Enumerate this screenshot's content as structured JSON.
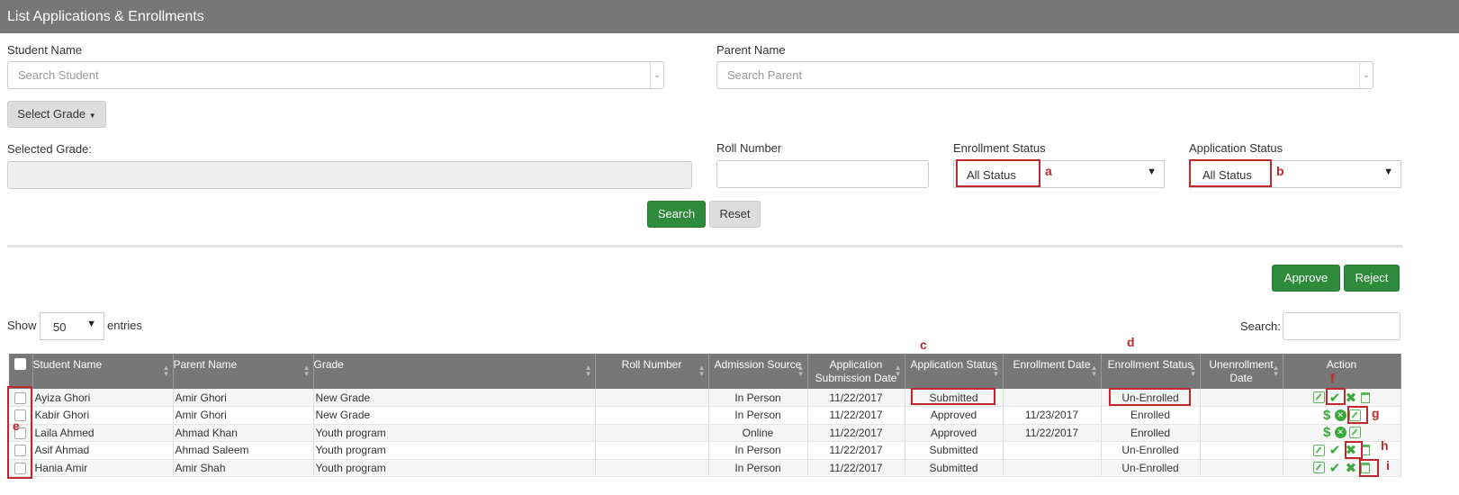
{
  "page_title": "List Applications & Enrollments",
  "filters": {
    "student_name_label": "Student Name",
    "student_placeholder": "Search Student",
    "parent_name_label": "Parent Name",
    "parent_placeholder": "Search Parent",
    "select_grade_label": "Select Grade",
    "selected_grade_label": "Selected Grade:",
    "roll_number_label": "Roll Number",
    "enrollment_status_label": "Enrollment Status",
    "enrollment_status_value": "All Status",
    "application_status_label": "Application Status",
    "application_status_value": "All Status",
    "search_button": "Search",
    "reset_button": "Reset"
  },
  "actions": {
    "approve_button": "Approve",
    "reject_button": "Reject"
  },
  "table_controls": {
    "show_label": "Show",
    "entries_value": "50",
    "entries_label": "entries",
    "search_label": "Search:"
  },
  "annotations": {
    "a": "a",
    "b": "b",
    "c": "c",
    "d": "d",
    "e": "e",
    "f": "f",
    "g": "g",
    "h": "h",
    "i": "i"
  },
  "columns": [
    "Student Name",
    "Parent Name",
    "Grade",
    "Roll Number",
    "Admission Source",
    "Application Submission Date",
    "Application Status",
    "Enrollment Date",
    "Enrollment Status",
    "Unenrollment Date",
    "Action"
  ],
  "rows": [
    {
      "student": "Ayiza Ghori",
      "parent": "Amir Ghori",
      "grade": "New Grade",
      "roll": "",
      "source": "In Person",
      "submitted": "11/22/2017",
      "app_status": "Submitted",
      "enroll_date": "",
      "enroll_status": "Un-Enrolled",
      "unenroll_date": "",
      "actions": [
        "edit-icon",
        "check-icon",
        "x-icon",
        "trash-icon"
      ]
    },
    {
      "student": "Kabir Ghori",
      "parent": "Amir Ghori",
      "grade": "New Grade",
      "roll": "",
      "source": "In Person",
      "submitted": "11/22/2017",
      "app_status": "Approved",
      "enroll_date": "11/23/2017",
      "enroll_status": "Enrolled",
      "unenroll_date": "",
      "actions": [
        "dollar-icon",
        "circle-x-icon",
        "edit-icon"
      ]
    },
    {
      "student": "Laila Ahmed",
      "parent": "Ahmad Khan",
      "grade": "Youth program",
      "roll": "",
      "source": "Online",
      "submitted": "11/22/2017",
      "app_status": "Approved",
      "enroll_date": "11/22/2017",
      "enroll_status": "Enrolled",
      "unenroll_date": "",
      "actions": [
        "dollar-icon",
        "circle-x-icon",
        "edit-icon"
      ]
    },
    {
      "student": "Asif Ahmad",
      "parent": "Ahmad Saleem",
      "grade": "Youth program",
      "roll": "",
      "source": "In Person",
      "submitted": "11/22/2017",
      "app_status": "Submitted",
      "enroll_date": "",
      "enroll_status": "Un-Enrolled",
      "unenroll_date": "",
      "actions": [
        "edit-icon",
        "check-icon",
        "x-icon",
        "trash-icon"
      ]
    },
    {
      "student": "Hania Amir",
      "parent": "Amir Shah",
      "grade": "Youth program",
      "roll": "",
      "source": "In Person",
      "submitted": "11/22/2017",
      "app_status": "Submitted",
      "enroll_date": "",
      "enroll_status": "Un-Enrolled",
      "unenroll_date": "",
      "actions": [
        "edit-icon",
        "check-icon",
        "x-icon",
        "trash-icon"
      ]
    }
  ]
}
